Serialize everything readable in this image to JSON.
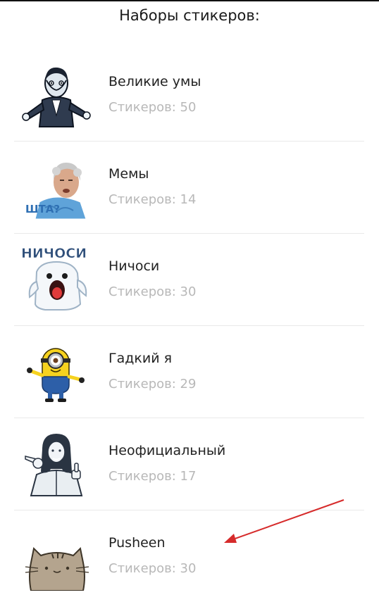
{
  "page": {
    "title": "Наборы стикеров:"
  },
  "packs": [
    {
      "name": "Великие умы",
      "count": "Стикеров: 50",
      "thumb_icon": "dali-sticker-icon"
    },
    {
      "name": "Мемы",
      "count": "Стикеров: 14",
      "thumb_icon": "meme-face-sticker-icon",
      "thumb_caption": "ШТА?"
    },
    {
      "name": "Ничоси",
      "count": "Стикеров: 30",
      "thumb_icon": "ghost-sticker-icon",
      "thumb_caption": "НИЧОСИ"
    },
    {
      "name": "Гадкий я",
      "count": "Стикеров: 29",
      "thumb_icon": "minion-sticker-icon"
    },
    {
      "name": "Неофициальный",
      "count": "Стикеров: 17",
      "thumb_icon": "jesus-sticker-icon"
    },
    {
      "name": "Pusheen",
      "count": "Стикеров: 30",
      "thumb_icon": "pusheen-cat-sticker-icon"
    }
  ],
  "colors": {
    "secondary_text": "#b8b8b8",
    "divider": "#e9e9e9",
    "annotation_arrow": "#d62b2b"
  }
}
